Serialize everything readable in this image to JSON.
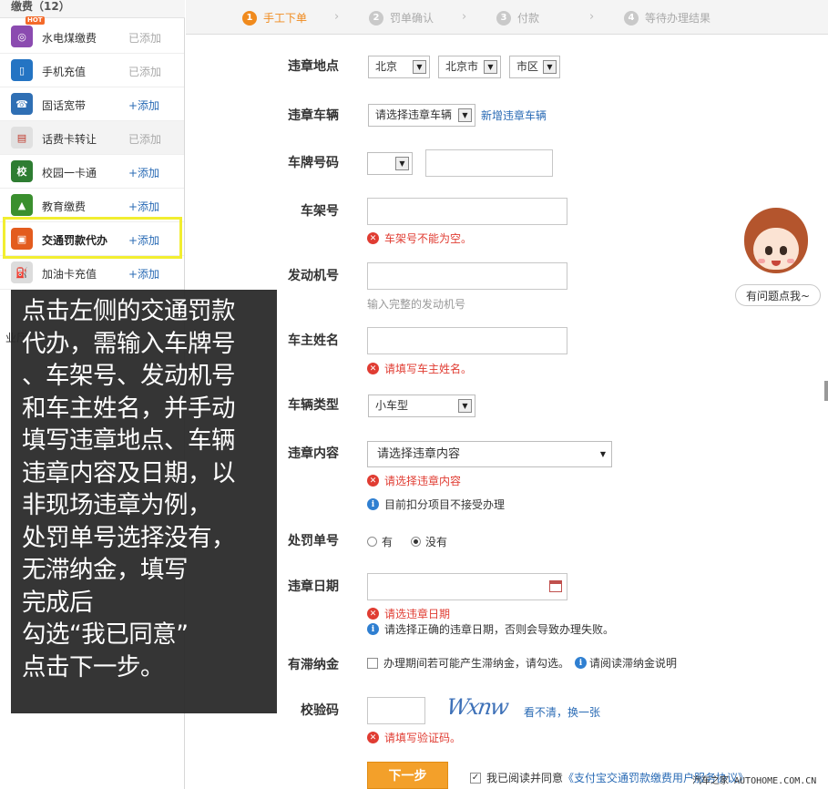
{
  "sidebar": {
    "header": "缴费（12）",
    "items": [
      {
        "label": "水电煤缴费",
        "action": "已添加",
        "icon": "utility-icon",
        "color": "#8b4bb0",
        "badge": "HOT",
        "glyph": "◎"
      },
      {
        "label": "手机充值",
        "action": "已添加",
        "icon": "mobile-icon",
        "color": "#2474c3",
        "glyph": "▯"
      },
      {
        "label": "固话宽带",
        "action": "+添加",
        "icon": "landline-icon",
        "color": "#2f6fb4",
        "glyph": "☎"
      },
      {
        "label": "话费卡转让",
        "action": "已添加",
        "icon": "phonecard-icon",
        "color": "#e0e0e0",
        "glyph": "▤"
      },
      {
        "label": "校园一卡通",
        "action": "+添加",
        "icon": "campus-card-icon",
        "color": "#2e7d32",
        "glyph": "校"
      },
      {
        "label": "教育缴费",
        "action": "+添加",
        "icon": "education-icon",
        "color": "#3a8f2e",
        "glyph": "▲"
      },
      {
        "label": "交通罚款代办",
        "action": "+添加",
        "icon": "traffic-fine-icon",
        "color": "#e35c1e",
        "glyph": "▣"
      },
      {
        "label": "加油卡充值",
        "action": "+添加",
        "icon": "fuel-card-icon",
        "color": "#dcdcdc",
        "glyph": "⛽"
      }
    ],
    "hidden_partial": [
      "业厅"
    ]
  },
  "overlay": {
    "text": "点击左侧的交通罚款\n代办，需输入车牌号\n、车架号、发动机号\n和车主姓名，并手动\n填写违章地点、车辆\n违章内容及日期，以\n非现场违章为例，\n处罚单号选择没有，\n无滞纳金，填写\n完成后\n勾选“我已同意”\n点击下一步。"
  },
  "steps": [
    {
      "num": "1",
      "label": "手工下单"
    },
    {
      "num": "2",
      "label": "罚单确认"
    },
    {
      "num": "3",
      "label": "付款"
    },
    {
      "num": "4",
      "label": "等待办理结果"
    }
  ],
  "form": {
    "location": {
      "label": "违章地点",
      "province": "北京",
      "city": "北京市",
      "district": "市区"
    },
    "vehicle": {
      "label": "违章车辆",
      "select": "请选择违章车辆",
      "add_link": "新增违章车辆"
    },
    "plate": {
      "label": "车牌号码",
      "prefix": "",
      "value": ""
    },
    "frame": {
      "label": "车架号",
      "error": "车架号不能为空。"
    },
    "engine": {
      "label": "发动机号",
      "hint": "输入完整的发动机号"
    },
    "owner": {
      "label": "车主姓名",
      "error": "请填写车主姓名。"
    },
    "type": {
      "label": "车辆类型",
      "select": "小车型"
    },
    "content": {
      "label": "违章内容",
      "select": "请选择违章内容",
      "error": "请选择违章内容",
      "info": "目前扣分项目不接受办理"
    },
    "ticket": {
      "label": "处罚单号",
      "option_yes": "有",
      "option_no": "没有"
    },
    "date": {
      "label": "违章日期",
      "error": "请选违章日期",
      "info": "请选择正确的违章日期，否则会导致办理失败。"
    },
    "late_fee": {
      "label": "有滞纳金",
      "checkbox_text": "办理期间若可能产生滞纳金，请勾选。",
      "info_link": "请阅读滞纳金说明"
    },
    "captcha": {
      "label": "校验码",
      "image_text": "Wxnw",
      "refresh_link": "看不清，换一张",
      "error": "请填写验证码。"
    },
    "submit": {
      "label": "下一步",
      "agree_text": "我已阅读并同意",
      "agree_link": "《支付宝交通罚款缴费用户服务协议》"
    }
  },
  "helper": {
    "bubble": "有问题点我~"
  },
  "watermark": "汽车之家 AUTOHOME.COM.CN"
}
